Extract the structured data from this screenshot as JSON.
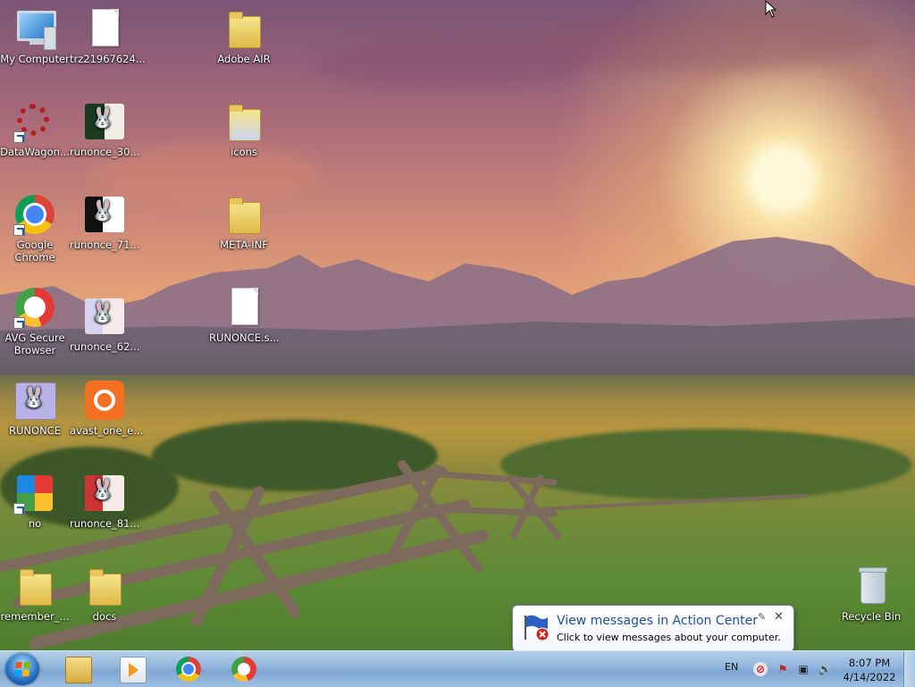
{
  "desktop": {
    "icons": [
      {
        "id": "my-computer",
        "label": "My Computer"
      },
      {
        "id": "trz-file",
        "label": "trz21967624..."
      },
      {
        "id": "adobe-air",
        "label": "Adobe AIR"
      },
      {
        "id": "datawagon",
        "label": "DataWagon..."
      },
      {
        "id": "runonce-30",
        "label": "runonce_30..."
      },
      {
        "id": "icons-folder",
        "label": "icons"
      },
      {
        "id": "google-chrome",
        "label": "Google Chrome"
      },
      {
        "id": "runonce-71",
        "label": "runonce_71..."
      },
      {
        "id": "meta-inf",
        "label": "META-INF"
      },
      {
        "id": "avg-browser",
        "label": "AVG Secure Browser"
      },
      {
        "id": "runonce-62",
        "label": "runonce_62..."
      },
      {
        "id": "runonce-s",
        "label": "RUNONCE.s..."
      },
      {
        "id": "runonce",
        "label": "RUNONCE"
      },
      {
        "id": "avast-one",
        "label": "avast_one_e..."
      },
      {
        "id": "no",
        "label": "no"
      },
      {
        "id": "runonce-81",
        "label": "runonce_81..."
      },
      {
        "id": "remember",
        "label": "remember_..."
      },
      {
        "id": "docs",
        "label": "docs"
      },
      {
        "id": "recycle-bin",
        "label": "Recycle Bin"
      }
    ]
  },
  "notification": {
    "title": "View messages in Action Center",
    "message": "Click to view messages about your computer.",
    "close": "✕",
    "pin": "✎"
  },
  "taskbar": {
    "pinned": [
      "Windows Explorer",
      "Windows Media Player",
      "Google Chrome",
      "AVG Secure Browser"
    ],
    "tray": {
      "language": "EN",
      "time": "8:07 PM",
      "date": "4/14/2022"
    }
  }
}
